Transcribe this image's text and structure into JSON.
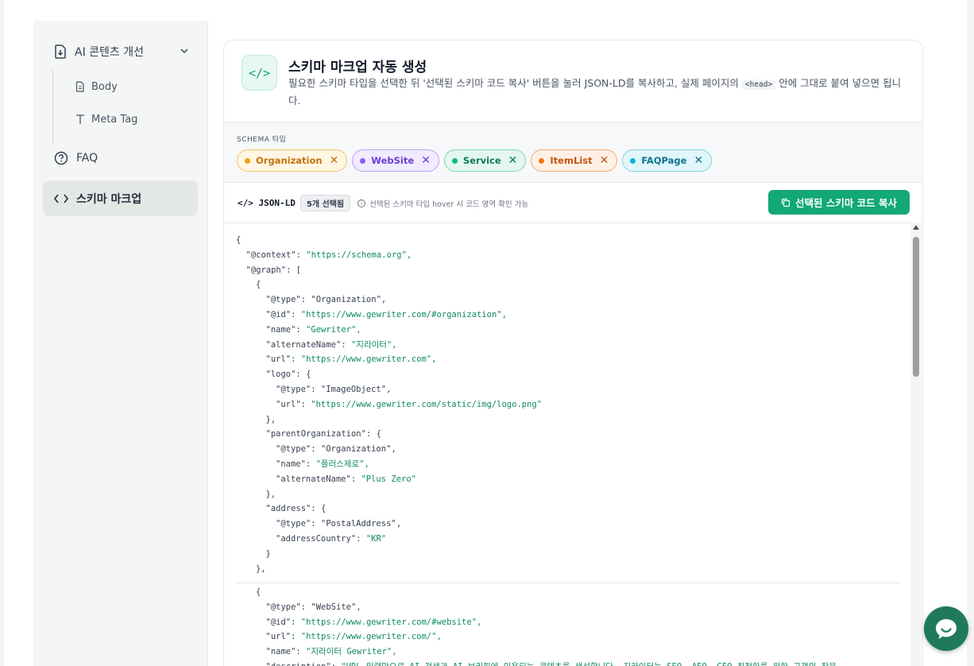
{
  "sidebar": {
    "group_label": "AI 콘텐츠 개선",
    "sub_items": [
      "Body",
      "Meta Tag"
    ],
    "faq_label": "FAQ",
    "active_label": "스키마 마크업"
  },
  "header": {
    "icon_text": "</>",
    "title": "스키마 마크업 자동 생성",
    "desc_before": "필요한 스키마 타입을 선택한 뒤 '선택된 스키마 코드 복사' 버튼을 눌러 JSON-LD를 복사하고, 실제 페이지의",
    "desc_code": "<head>",
    "desc_after": "안에 그대로 붙여 넣으면 됩니다."
  },
  "schema": {
    "label": "SCHEMA 타입",
    "tags": [
      {
        "name": "Organization",
        "color": "#f59e0b",
        "bg": "#fff6e3",
        "border": "#f3c46b",
        "text": "#c2710c"
      },
      {
        "name": "WebSite",
        "color": "#8b5cf6",
        "bg": "#f0ebfe",
        "border": "#b9a3f5",
        "text": "#6d3fd6"
      },
      {
        "name": "Service",
        "color": "#10b981",
        "bg": "#e3f7ef",
        "border": "#7fd4b3",
        "text": "#0f7a57"
      },
      {
        "name": "ItemList",
        "color": "#f97316",
        "bg": "#fff0e6",
        "border": "#f7a96e",
        "text": "#c2540c"
      },
      {
        "name": "FAQPage",
        "color": "#06b6d4",
        "bg": "#e1f6fa",
        "border": "#7fd3e3",
        "text": "#0e7490"
      }
    ]
  },
  "toolbar": {
    "title": "</> JSON-LD",
    "badge": "5개 선택됨",
    "hint": "선택된 스키마 타입 hover 시 코드 영역 확인 가능",
    "copy_label": "선택된 스키마 코드 복사"
  },
  "code_lines_1": [
    [
      0,
      "{",
      ""
    ],
    [
      1,
      "\"@context\": ",
      "\"https://schema.org\","
    ],
    [
      1,
      "\"@graph\": [",
      ""
    ],
    [
      2,
      "{",
      ""
    ],
    [
      3,
      "\"@type\": \"Organization\",",
      ""
    ],
    [
      3,
      "\"@id\": ",
      "\"https://www.gewriter.com/#organization\","
    ],
    [
      3,
      "\"name\": ",
      "\"Gewriter\","
    ],
    [
      3,
      "\"alternateName\": ",
      "\"지라이터\","
    ],
    [
      3,
      "\"url\": ",
      "\"https://www.gewriter.com\","
    ],
    [
      3,
      "\"logo\": {",
      ""
    ],
    [
      4,
      "\"@type\": \"ImageObject\",",
      ""
    ],
    [
      4,
      "\"url\": ",
      "\"https://www.gewriter.com/static/img/logo.png\""
    ],
    [
      3,
      "},",
      ""
    ],
    [
      3,
      "\"parentOrganization\": {",
      ""
    ],
    [
      4,
      "\"@type\": \"Organization\",",
      ""
    ],
    [
      4,
      "\"name\": ",
      "\"플러스제로\","
    ],
    [
      4,
      "\"alternateName\": ",
      "\"Plus Zero\""
    ],
    [
      3,
      "},",
      ""
    ],
    [
      3,
      "\"address\": {",
      ""
    ],
    [
      4,
      "\"@type\": \"PostalAddress\",",
      ""
    ],
    [
      4,
      "\"addressCountry\": ",
      "\"KR\""
    ],
    [
      3,
      "}",
      ""
    ],
    [
      2,
      "},",
      ""
    ]
  ],
  "code_lines_2": [
    [
      2,
      "{",
      ""
    ],
    [
      3,
      "\"@type\": \"WebSite\",",
      ""
    ],
    [
      3,
      "\"@id\": ",
      "\"https://www.gewriter.com/#website\","
    ],
    [
      3,
      "\"url\": ",
      "\"https://www.gewriter.com/\","
    ],
    [
      3,
      "\"name\": ",
      "\"지라이터 Gewriter\","
    ],
    [
      3,
      "\"description\": ",
      "\"URL 입력만으로 AI 검색과 AI 브리핑에 인용되는 콘텐츠를 생성합니다. 지라이터는 SEO, AEO, GEO 최적화를 위한 고객의 작문"
    ]
  ]
}
